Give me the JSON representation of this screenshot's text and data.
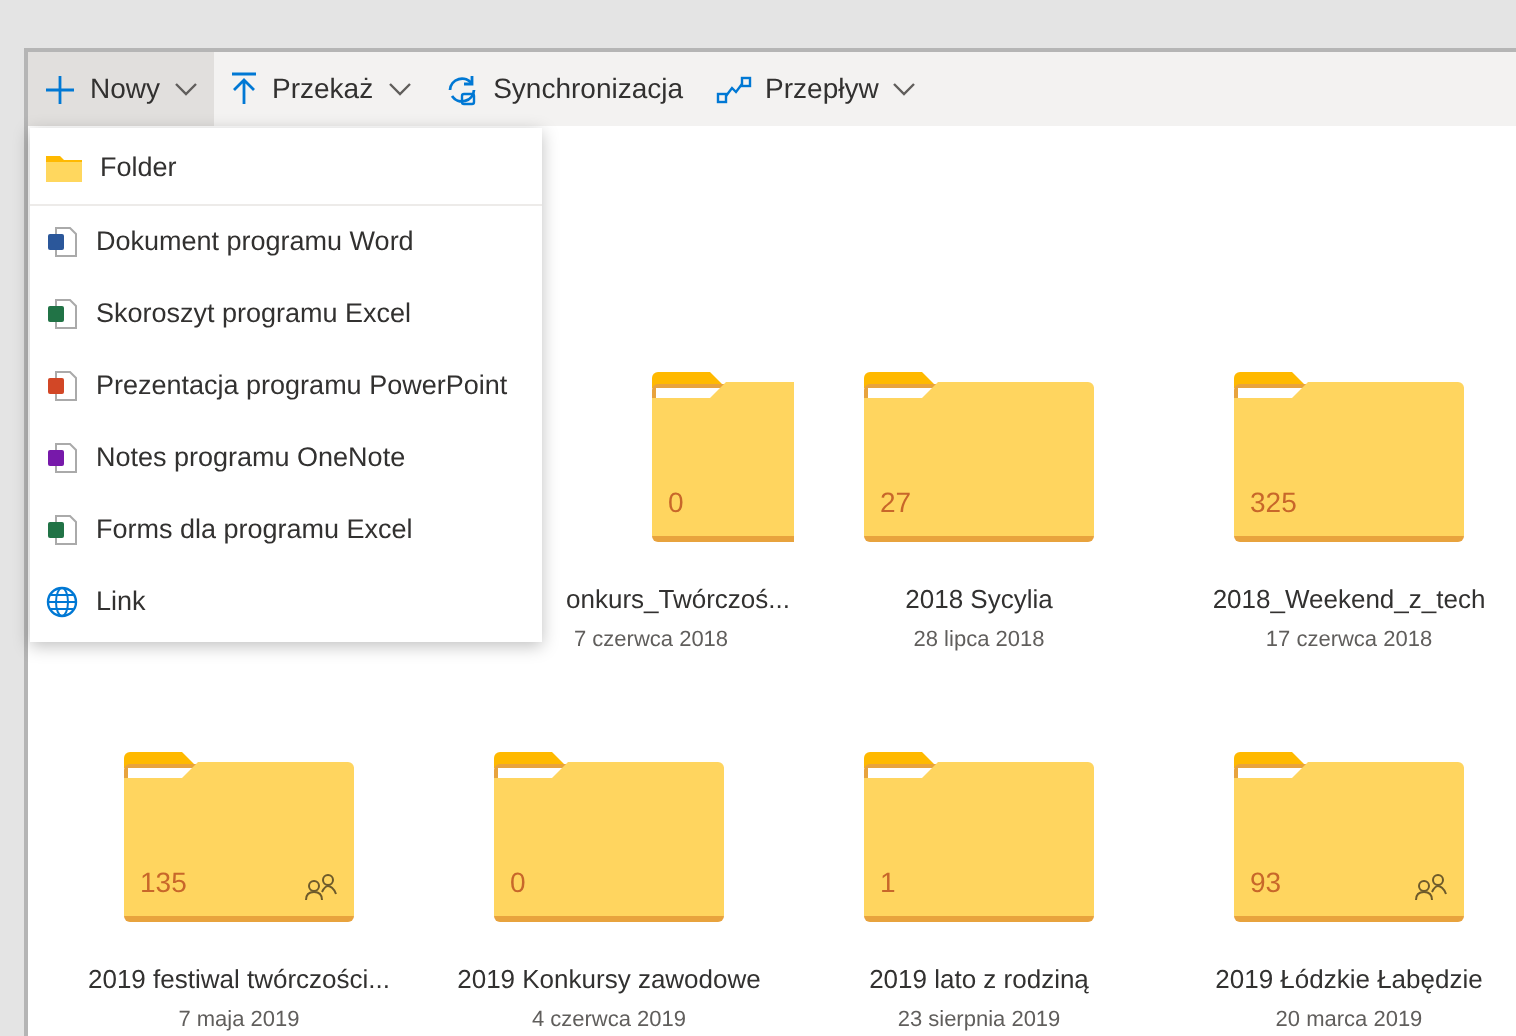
{
  "toolbar": [
    {
      "label": "Nowy",
      "dropdown": true,
      "selected": true
    },
    {
      "label": "Przekaż",
      "dropdown": true,
      "selected": false
    },
    {
      "label": "Synchronizacja",
      "dropdown": false,
      "selected": false
    },
    {
      "label": "Przepływ",
      "dropdown": true,
      "selected": false
    }
  ],
  "new_menu": [
    {
      "kind": "folder",
      "label": "Folder"
    },
    {
      "kind": "word",
      "label": "Dokument programu Word"
    },
    {
      "kind": "excel",
      "label": "Skoroszyt programu Excel"
    },
    {
      "kind": "powerpoint",
      "label": "Prezentacja programu PowerPoint"
    },
    {
      "kind": "onenote",
      "label": "Notes programu OneNote"
    },
    {
      "kind": "excel",
      "label": "Forms dla programu Excel"
    },
    {
      "kind": "link",
      "label": "Link"
    }
  ],
  "folders": [
    {
      "count": "0",
      "name": "onkurs_Twórczoś...",
      "date": "7 czerwca 2018",
      "shared": false
    },
    {
      "count": "27",
      "name": "2018 Sycylia",
      "date": "28 lipca 2018",
      "shared": false
    },
    {
      "count": "325",
      "name": "2018_Weekend_z_tech",
      "date": "17 czerwca 2018",
      "shared": false
    },
    {
      "count": "135",
      "name": "2019 festiwal twórczości...",
      "date": "7 maja 2019",
      "shared": true
    },
    {
      "count": "0",
      "name": "2019 Konkursy zawodowe",
      "date": "4 czerwca 2019",
      "shared": false
    },
    {
      "count": "1",
      "name": "2019 lato z rodziną",
      "date": "23 sierpnia 2019",
      "shared": false
    },
    {
      "count": "93",
      "name": "2019 Łódzkie Łabędzie",
      "date": "20 marca 2019",
      "shared": true
    }
  ]
}
